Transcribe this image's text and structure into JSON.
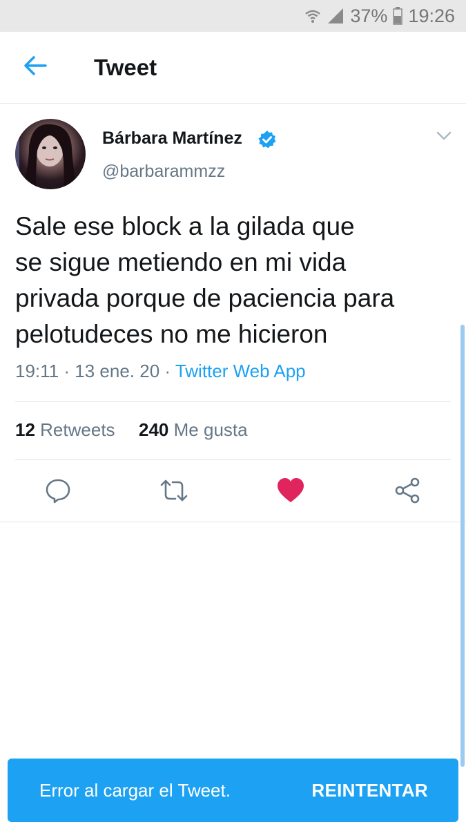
{
  "status_bar": {
    "battery": "37%",
    "time": "19:26"
  },
  "header": {
    "title": "Tweet"
  },
  "tweet": {
    "author_name": "Bárbara Martínez",
    "handle": "@barbarammzz",
    "text_lines": [
      "Sale ese block a la gilada que",
      "se sigue metiendo en mi vida",
      "privada porque de paciencia para",
      "pelotudeces no me hicieron"
    ],
    "time": "19:11",
    "date": "13 ene. 20",
    "source": "Twitter Web App",
    "retweets_count": "12",
    "retweets_label": "Retweets",
    "likes_count": "240",
    "likes_label": "Me gusta"
  },
  "snackbar": {
    "message": "Error al cargar el Tweet.",
    "action": "REINTENTAR"
  },
  "colors": {
    "accent": "#1da1f2",
    "like": "#e0245e",
    "secondary_text": "#657786"
  },
  "icons": [
    "wifi-icon",
    "signal-icon",
    "battery-icon",
    "back-arrow-icon",
    "verified-badge-icon",
    "caret-down-icon",
    "reply-icon",
    "retweet-icon",
    "like-heart-icon",
    "share-icon"
  ]
}
